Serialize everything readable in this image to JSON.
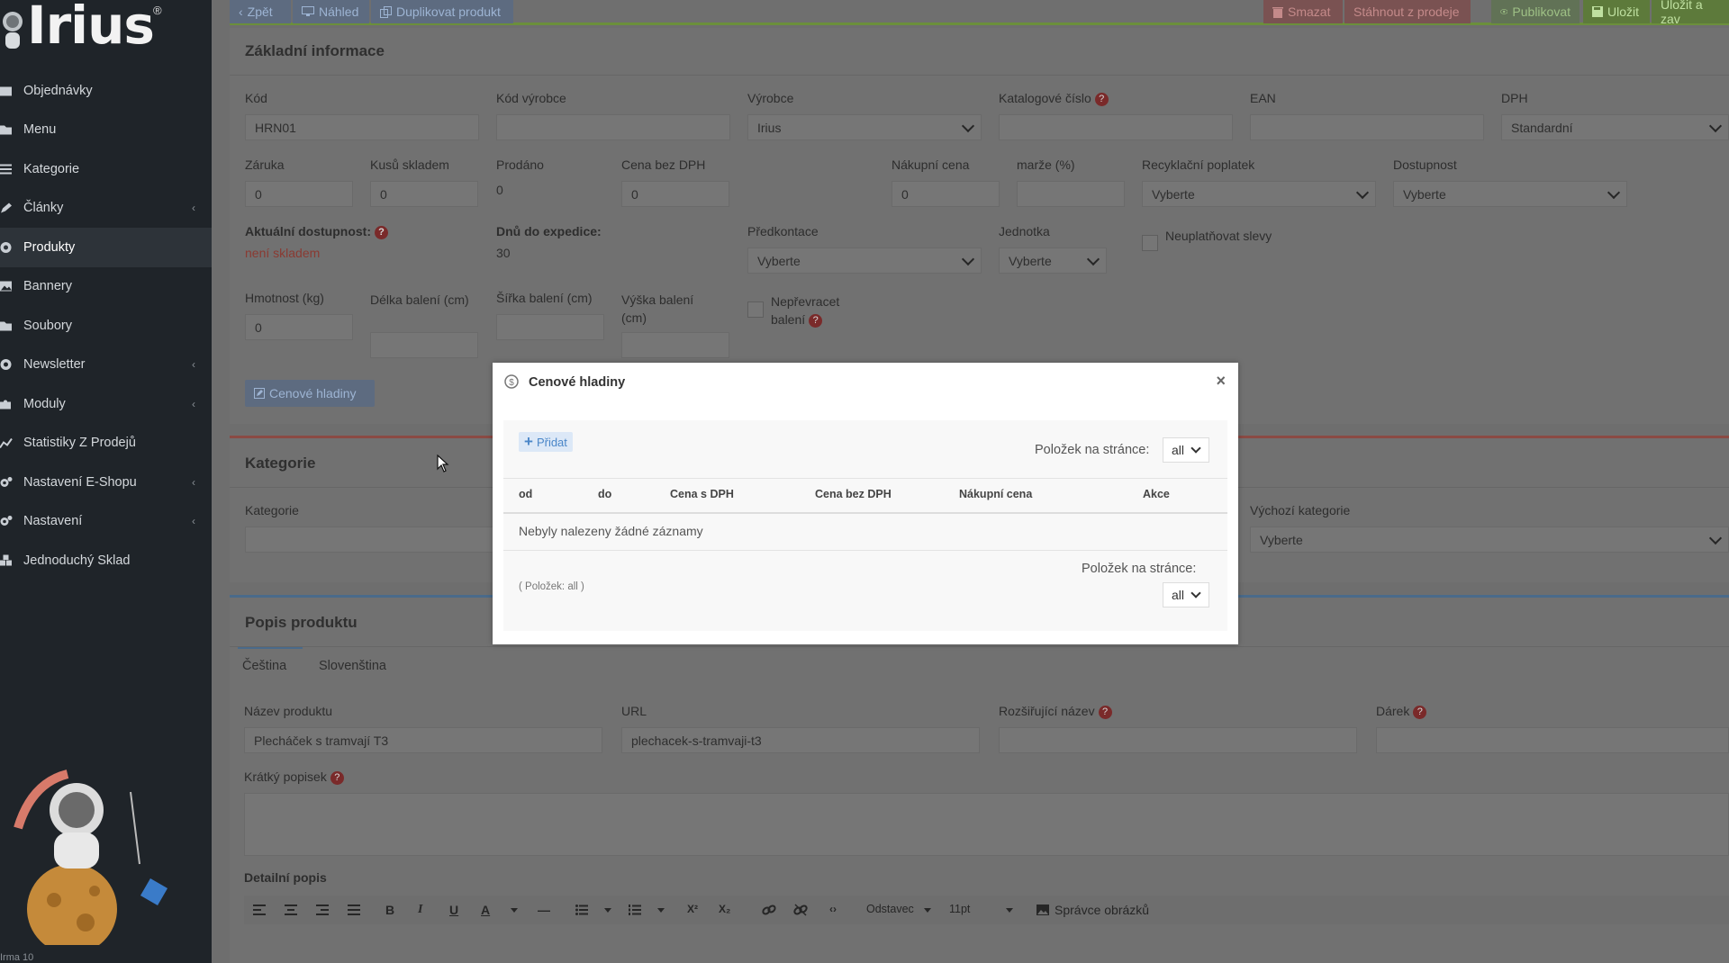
{
  "sidebar": {
    "logo": "Irius",
    "logo_reg": "®",
    "items": [
      {
        "label": "Objednávky",
        "icon": "inbox-icon",
        "chevron": false,
        "active": false
      },
      {
        "label": "Menu",
        "icon": "folder-icon",
        "chevron": false,
        "active": false
      },
      {
        "label": "Kategorie",
        "icon": "list-icon",
        "chevron": false,
        "active": false
      },
      {
        "label": "Články",
        "icon": "pencil-icon",
        "chevron": true,
        "active": false
      },
      {
        "label": "Produkty",
        "icon": "globe-icon",
        "chevron": false,
        "active": true
      },
      {
        "label": "Bannery",
        "icon": "image-icon",
        "chevron": false,
        "active": false
      },
      {
        "label": "Soubory",
        "icon": "file-icon",
        "chevron": false,
        "active": false
      },
      {
        "label": "Newsletter",
        "icon": "at-icon",
        "chevron": true,
        "active": false
      },
      {
        "label": "Moduly",
        "icon": "puzzle-icon",
        "chevron": true,
        "active": false
      },
      {
        "label": "Statistiky Z Prodejů",
        "icon": "chart-icon",
        "chevron": false,
        "active": false
      },
      {
        "label": "Nastavení E-Shopu",
        "icon": "cogs-icon",
        "chevron": true,
        "active": false
      },
      {
        "label": "Nastavení",
        "icon": "cogs-icon",
        "chevron": true,
        "active": false
      },
      {
        "label": "Jednoduchý Sklad",
        "icon": "boxes-icon",
        "chevron": false,
        "active": false
      }
    ],
    "chevron_glyph": "‹",
    "footer": "Irma 10"
  },
  "toolbar": {
    "back": "Zpět",
    "preview": "Náhled",
    "duplicate": "Duplikovat produkt",
    "delete": "Smazat",
    "withdraw": "Stáhnout z prodeje",
    "publish": "Publikovat",
    "save": "Uložit",
    "save_close": "Uložit a zav"
  },
  "basic": {
    "title": "Základní informace",
    "kod_label": "Kód",
    "kod_value": "HRN01",
    "kod_vyrobce_label": "Kód výrobce",
    "vyrobce_label": "Výrobce",
    "vyrobce_value": "Irius",
    "katalog_label": "Katalogové číslo",
    "ean_label": "EAN",
    "dph_label": "DPH",
    "dph_value": "Standardní",
    "zaruka_label": "Záruka",
    "zaruka_value": "0",
    "kusu_label": "Kusů skladem",
    "kusu_value": "0",
    "prodano_label": "Prodáno",
    "prodano_value": "0",
    "cena_bez_label": "Cena bez DPH",
    "cena_bez_value": "0",
    "nakupni_label": "Nákupní cena",
    "nakupni_value": "0",
    "marze_label": "marže (%)",
    "recyklacni_label": "Recyklační poplatek",
    "recyklacni_value": "Vyberte",
    "dostupnost_label": "Dostupnost",
    "dostupnost_value": "Vyberte",
    "aktualni_label": "Aktuální dostupnost:",
    "aktualni_value": "není skladem",
    "dnu_label": "Dnů do expedice:",
    "dnu_value": "30",
    "predkontace_label": "Předkontace",
    "predkontace_value": "Vyberte",
    "jednotka_label": "Jednotka",
    "jednotka_value": "Vyberte",
    "neuplatnovat_label": "Neuplatňovat slevy",
    "hmotnost_label": "Hmotnost (kg)",
    "hmotnost_value": "0",
    "delka_label": "Délka balení (cm)",
    "sirka_label": "Šířka balení (cm)",
    "vyska_label": "Výška balení (cm)",
    "neprevracet_label": "Nepřevracet balení",
    "cenove_btn": "Cenové hladiny"
  },
  "category": {
    "title": "Kategorie",
    "kategorie_label": "Kategorie",
    "vychozi_label": "Výchozí kategorie",
    "vychozi_value": "Vyberte"
  },
  "description": {
    "title": "Popis produktu",
    "tabs": [
      "Čeština",
      "Slovenština"
    ],
    "nazev_label": "Název produktu",
    "nazev_value": "Plecháček s tramvají T3",
    "url_label": "URL",
    "url_value": "plechacek-s-tramvaji-t3",
    "rozsirujici_label": "Rozšiřující název",
    "darek_label": "Dárek",
    "kratky_label": "Krátký popisek",
    "detailni_label": "Detailní popis",
    "toolbar": {
      "bold": "B",
      "italic": "I",
      "underline": "U",
      "font_color": "A",
      "hr": "—",
      "code": "‹›",
      "superscript": "X²",
      "subscript": "X₂",
      "paragraph": "Odstavec",
      "size": "11pt",
      "images": "Správce obrázků"
    }
  },
  "modal": {
    "title": "Cenové hladiny",
    "add_label": "Přidat",
    "per_page_label": "Položek na stránce:",
    "per_page_value": "all",
    "columns": [
      "od",
      "do",
      "Cena s DPH",
      "Cena bez DPH",
      "Nákupní cena",
      "Akce"
    ],
    "empty": "Nebyly nalezeny žádné záznamy",
    "count": "( Položek: all )",
    "per_page_label_bottom": "Položek na stránce:",
    "per_page_value_bottom": "all"
  },
  "colors": {
    "sidebar": "#1f2429",
    "overlay": "#6e6e6e",
    "accent_blue": "#4a86c8",
    "danger": "#c0392b",
    "success": "#6b8f3b"
  },
  "help_glyph": "?",
  "close_glyph": "×",
  "plus_glyph": "+"
}
